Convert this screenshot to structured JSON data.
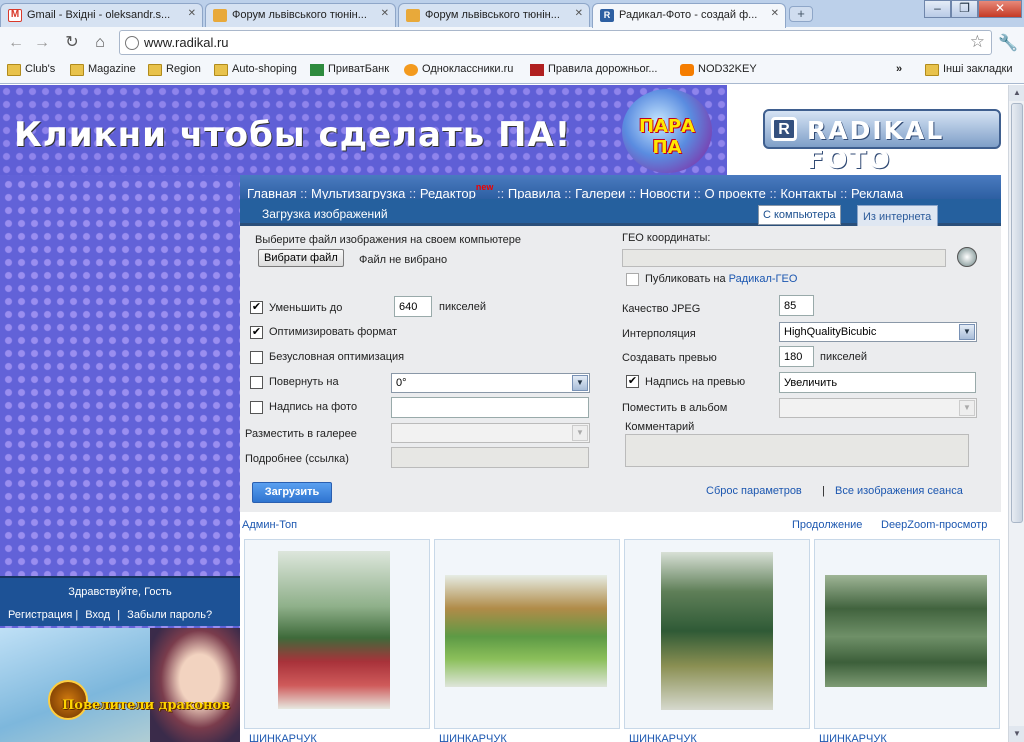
{
  "browser": {
    "tabs": [
      {
        "label": "Gmail - Вхідні - oleksandr.s...",
        "icon_color": "#d93a2b"
      },
      {
        "label": "Форум львівського тюнін...",
        "icon_color": "#e0a020"
      },
      {
        "label": "Форум львівського тюнін...",
        "icon_color": "#e0a020"
      },
      {
        "label": "Радикал-Фото - создай ф...",
        "icon_color": "#2d5fa2"
      }
    ],
    "new_tab_label": "+",
    "url": "www.radikal.ru",
    "bookmarks": [
      {
        "label": "Club's",
        "icon": "folder-icon"
      },
      {
        "label": "Magazine",
        "icon": "folder-icon"
      },
      {
        "label": "Region",
        "icon": "folder-icon"
      },
      {
        "label": "Auto-shoping",
        "icon": "folder-icon"
      },
      {
        "label": "ПриватБанк",
        "icon": "privatbank-icon"
      },
      {
        "label": "Одноклассники.ru",
        "icon": "odnoklassniki-icon"
      },
      {
        "label": "Правила дорожньог...",
        "icon": "site-icon"
      },
      {
        "label": "NOD32KEY",
        "icon": "blogger-icon"
      }
    ],
    "bookmarks_overflow": "»",
    "other_bookmarks": "Інші закладки"
  },
  "banner": {
    "slogan": "Кликни чтобы сделать ПА!",
    "badge": "ПАРА ПА",
    "logo_text": "RADIKAL FOTO",
    "logo_letter": "R"
  },
  "nav": {
    "items": [
      "Главная",
      "Мультизагрузка",
      "Редактор",
      "Правила",
      "Галереи",
      "Новости",
      "О проекте",
      "Контакты",
      "Реклама"
    ],
    "new_badge": "new",
    "separator": "::"
  },
  "upload": {
    "title": "Загрузка изображений",
    "tabs": [
      "С компьютера",
      "Из интернета"
    ],
    "file_prompt": "Выберите файл изображения на своем компьютере",
    "choose_button": "Вибрати файл",
    "no_file": "Файл не вибрано",
    "geo_label": "ГЕО координаты:",
    "geo_value": "",
    "publish_label": "Публиковать на",
    "publish_link": "Радикал-ГЕО",
    "resize_label": "Уменьшить до",
    "resize_value": "640",
    "resize_unit": "пикселей",
    "optimize_label": "Оптимизировать формат",
    "unconditional_label": "Безусловная оптимизация",
    "rotate_label": "Повернуть на",
    "rotate_value": "0°",
    "caption_label": "Надпись на фото",
    "caption_value": "",
    "gallery_label": "Разместить в галерее",
    "gallery_value": "",
    "details_label": "Подробнее (ссылка)",
    "details_value": "",
    "jpeg_label": "Качество JPEG",
    "jpeg_value": "85",
    "interp_label": "Интерполяция",
    "interp_value": "HighQualityBicubic",
    "preview_label": "Создавать превью",
    "preview_value": "180",
    "preview_unit": "пикселей",
    "preview_caption_label": "Надпись на превью",
    "preview_caption_value": "Увеличить",
    "album_label": "Поместить в альбом",
    "album_value": "",
    "comment_label": "Комментарий",
    "comment_value": "",
    "submit_label": "Загрузить",
    "reset_link": "Сброс параметров",
    "link_sep": "|",
    "session_link": "Все изображения сеанса",
    "checked": {
      "resize": true,
      "optimize": true,
      "unconditional": false,
      "rotate": false,
      "caption": false,
      "publish": false,
      "preview_caption": true
    }
  },
  "gallery": {
    "admin_top": "Админ-Топ",
    "continue_link": "Продолжение",
    "deepzoom_link": "DeepZoom-просмотр",
    "cards": [
      {
        "owner": "ШИНКАРЧУК"
      },
      {
        "owner": "ШИНКАРЧУК"
      },
      {
        "owner": "ШИНКАРЧУК"
      },
      {
        "owner": "ШИНКАРЧУК"
      }
    ]
  },
  "user": {
    "greeting": "Здравствуйте, Гость",
    "register": "Регистрация",
    "login": "Вход",
    "forgot": "Забыли пароль?",
    "sep": "|"
  },
  "ad": {
    "title": "Повелители драконов"
  }
}
